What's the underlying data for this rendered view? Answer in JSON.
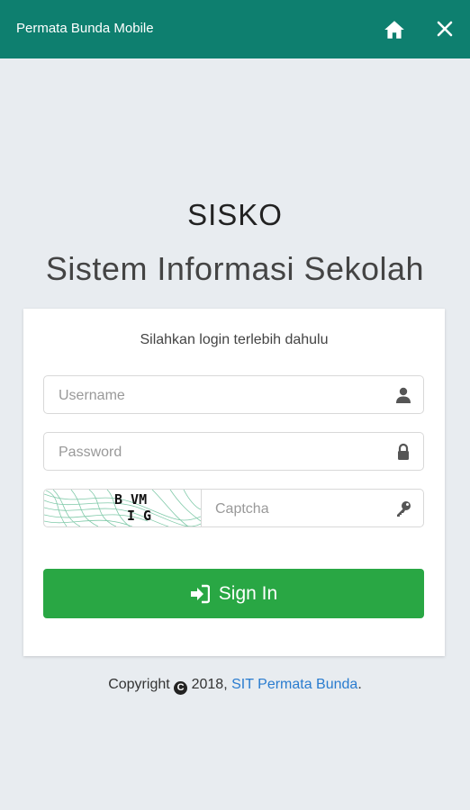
{
  "header": {
    "title": "Permata Bunda Mobile"
  },
  "brand": {
    "name": "SISKO",
    "subtitle": "Sistem Informasi Sekolah"
  },
  "login": {
    "prompt": "Silahkan login terlebih dahulu",
    "username_placeholder": "Username",
    "password_placeholder": "Password",
    "captcha_placeholder": "Captcha",
    "captcha_text": "B VM I G",
    "signin_label": "Sign In"
  },
  "footer": {
    "prefix": "Copyright",
    "symbol": "C",
    "year": "2018,",
    "link_text": "SIT Permata Bunda",
    "suffix": "."
  },
  "colors": {
    "header": "#0e7f6f",
    "background": "#e8ecf0",
    "signin": "#29a744",
    "link": "#2a7ccf"
  }
}
